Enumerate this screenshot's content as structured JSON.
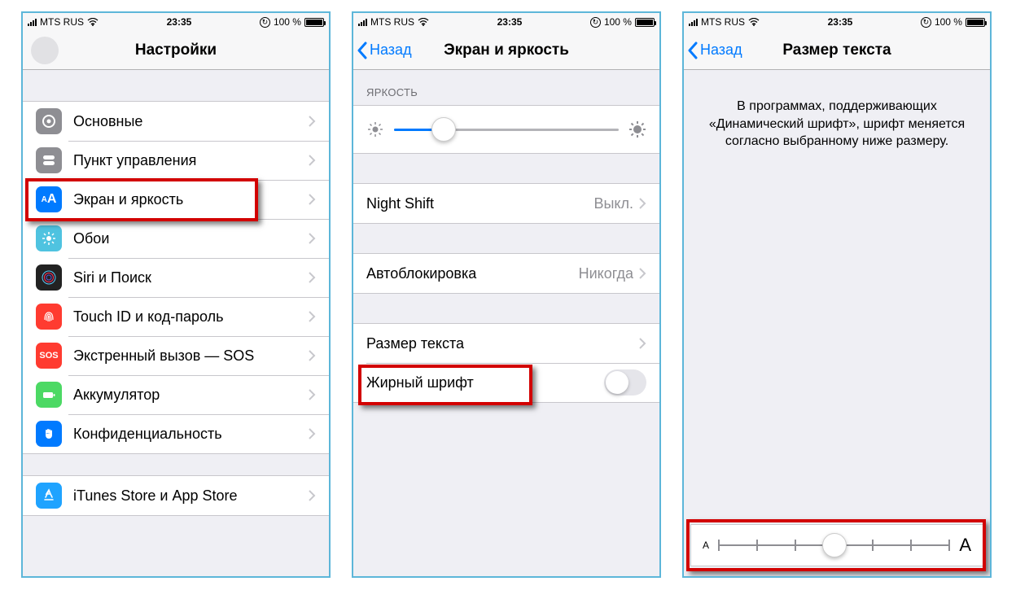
{
  "status": {
    "carrier": "MTS RUS",
    "time": "23:35",
    "battery_text": "100 %"
  },
  "back_label": "Назад",
  "screen1": {
    "title": "Настройки",
    "items": [
      {
        "name": "general",
        "label": "Основные"
      },
      {
        "name": "control-center",
        "label": "Пункт управления"
      },
      {
        "name": "display",
        "label": "Экран и яркость"
      },
      {
        "name": "wallpaper",
        "label": "Обои"
      },
      {
        "name": "siri",
        "label": "Siri и Поиск"
      },
      {
        "name": "touchid",
        "label": "Touch ID и код-пароль"
      },
      {
        "name": "sos",
        "label": "Экстренный вызов — SOS"
      },
      {
        "name": "battery",
        "label": "Аккумулятор"
      },
      {
        "name": "privacy",
        "label": "Конфиденциальность"
      }
    ],
    "store_label": "iTunes Store и App Store"
  },
  "screen2": {
    "title": "Экран и яркость",
    "brightness_header": "ЯРКОСТЬ",
    "brightness_value_pct": 22,
    "night_shift": {
      "label": "Night Shift",
      "value": "Выкл."
    },
    "auto_lock": {
      "label": "Автоблокировка",
      "value": "Никогда"
    },
    "text_size_label": "Размер текста",
    "bold_text_label": "Жирный шрифт",
    "bold_text_on": false
  },
  "screen3": {
    "title": "Размер текста",
    "description": "В программах, поддерживающих «Динамический шрифт», шрифт меняется согласно выбранному ниже размеру.",
    "slider": {
      "steps": 7,
      "index": 3
    }
  }
}
